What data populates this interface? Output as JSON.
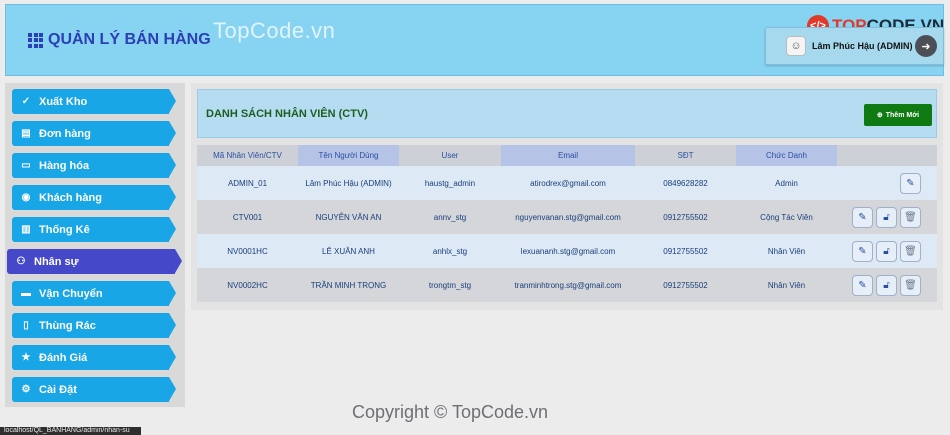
{
  "header": {
    "app_title": "QUẢN LÝ BÁN HÀNG",
    "watermark": "TopCode.vn",
    "brand_prefix": "TOP",
    "brand_suffix": "CODE.VN",
    "user_name": "Lâm Phúc Hậu (ADMIN)"
  },
  "sidebar": {
    "items": [
      {
        "label": "Xuất Kho",
        "icon": "check-icon"
      },
      {
        "label": "Đơn hàng",
        "icon": "document-icon"
      },
      {
        "label": "Hàng hóa",
        "icon": "box-icon"
      },
      {
        "label": "Khách hàng",
        "icon": "user-circle-icon"
      },
      {
        "label": "Thống Kê",
        "icon": "bar-chart-icon"
      },
      {
        "label": "Nhân sự",
        "icon": "users-icon",
        "active": true
      },
      {
        "label": "Vận Chuyển",
        "icon": "truck-icon"
      },
      {
        "label": "Thùng Rác",
        "icon": "trash-icon"
      },
      {
        "label": "Đánh Giá",
        "icon": "star-icon"
      },
      {
        "label": "Cài Đặt",
        "icon": "gear-icon"
      }
    ]
  },
  "main": {
    "title": "DANH SÁCH NHÂN VIÊN (CTV)",
    "add_button": "Thêm Mới",
    "columns": [
      "Mã Nhân Viên/CTV",
      "Tên Người Dùng",
      "User",
      "Email",
      "SĐT",
      "Chức Danh",
      ""
    ],
    "rows": [
      {
        "id": "ADMIN_01",
        "name": "Lâm Phúc Hậu (ADMIN)",
        "user": "haustg_admin",
        "email": "atirodrex@gmail.com",
        "phone": "0849628282",
        "role": "Admin"
      },
      {
        "id": "CTV001",
        "name": "NGUYỄN VĂN AN",
        "user": "annv_stg",
        "email": "nguyenvanan.stg@gmail.com",
        "phone": "0912755502",
        "role": "Cộng Tác Viên"
      },
      {
        "id": "NV0001HC",
        "name": "LÊ XUÂN ANH",
        "user": "anhlx_stg",
        "email": "lexuananh.stg@gmail.com",
        "phone": "0912755502",
        "role": "Nhân Viên"
      },
      {
        "id": "NV0002HC",
        "name": "TRẦN MINH TRỌNG",
        "user": "trongtm_stg",
        "email": "tranminhtrong.stg@gmail.com",
        "phone": "0912755502",
        "role": "Nhân Viên"
      }
    ]
  },
  "footer": {
    "watermark": "Copyright © TopCode.vn",
    "status_url": "localhost/QL_BANHANG/admin/nhan-su"
  },
  "colors": {
    "header_bg": "#87d3f2",
    "nav_bg": "#19a6e6",
    "nav_active_bg": "#4548c9",
    "add_button_bg": "#0f7a12",
    "title_color": "#1b5e20"
  }
}
